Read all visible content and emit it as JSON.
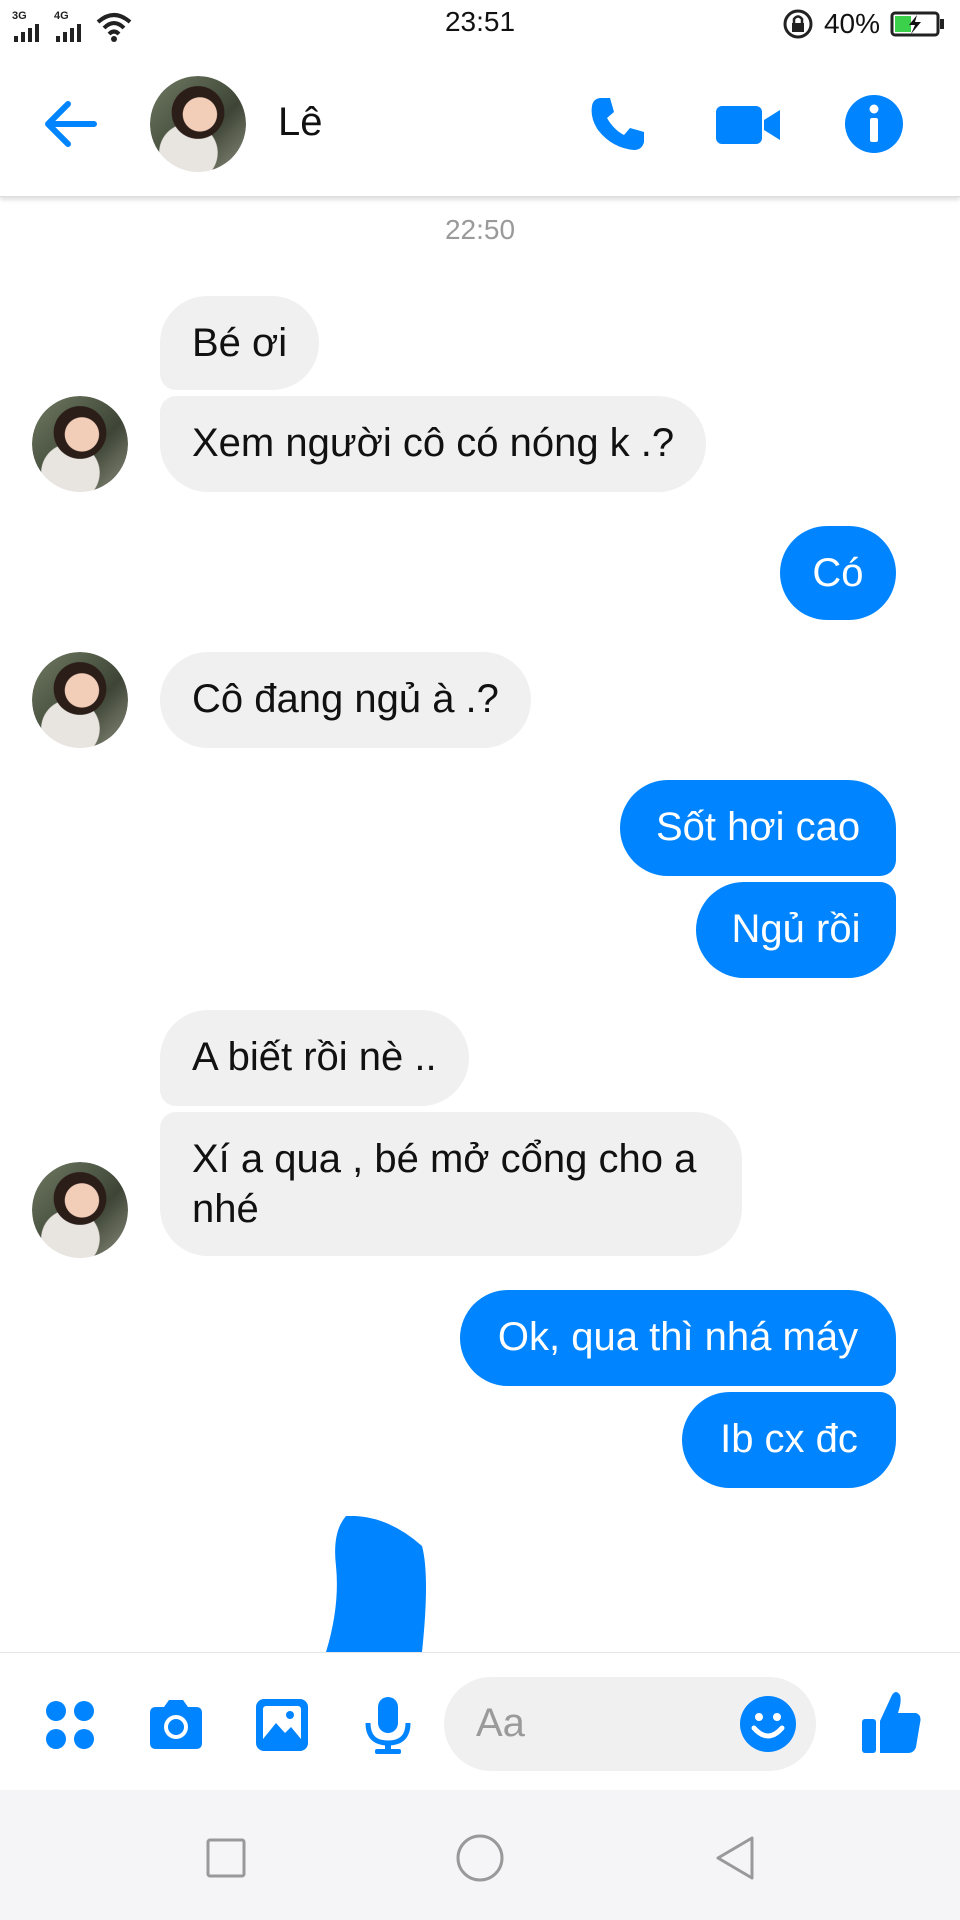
{
  "status_bar": {
    "net1": "3G",
    "net2": "4G",
    "time": "23:51",
    "battery_percent": "40%",
    "battery_level": 0.4
  },
  "header": {
    "contact_name": "Lê",
    "icons": [
      "back-arrow-icon",
      "avatar",
      "phone-icon",
      "video-icon",
      "info-icon"
    ]
  },
  "chat": {
    "timestamp": "22:50",
    "messages": [
      {
        "from": "contact",
        "text": "Bé ơi"
      },
      {
        "from": "contact",
        "text": "Xem người cô có nóng k .?"
      },
      {
        "from": "me",
        "text": "Có"
      },
      {
        "from": "contact",
        "text": "Cô đang ngủ à .?"
      },
      {
        "from": "me",
        "text": "Sốt hơi cao"
      },
      {
        "from": "me",
        "text": "Ngủ rồi"
      },
      {
        "from": "contact",
        "text": "A biết rồi nè .."
      },
      {
        "from": "contact",
        "text": "Xí a qua , bé mở cổng cho a nhé"
      },
      {
        "from": "me",
        "text": "Ok, qua thì nhá máy"
      },
      {
        "from": "me",
        "text": "Ib cx đc"
      }
    ]
  },
  "composer": {
    "placeholder": "Aa",
    "icons": [
      "apps-icon",
      "camera-icon",
      "gallery-icon",
      "microphone-icon",
      "emoji-icon",
      "thumbs-up-icon"
    ]
  },
  "colors": {
    "accent": "#0084ff",
    "incoming_bubble": "#f0f0f0",
    "timestamp": "#9a9a9a"
  }
}
